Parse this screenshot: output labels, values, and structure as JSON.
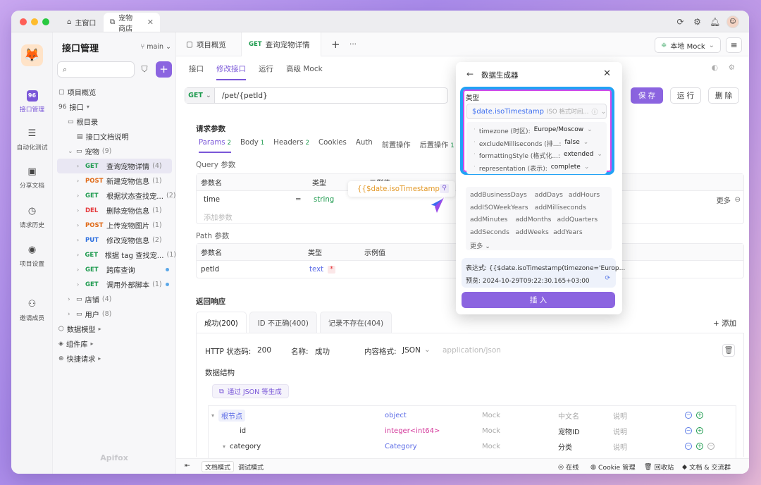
{
  "window": {
    "tabs": [
      {
        "label": "主窗口"
      },
      {
        "label": "宠物商店"
      }
    ]
  },
  "rail": {
    "items": [
      "接口管理",
      "自动化测试",
      "分享文档",
      "请求历史",
      "项目设置",
      "邀请成员"
    ]
  },
  "sidebar": {
    "title": "接口管理",
    "branch": "main",
    "tree": [
      {
        "label": "项目概览",
        "indent": 0,
        "icon": "▢"
      },
      {
        "label": "接口",
        "indent": 0,
        "icon": "96",
        "suffix": "▾"
      },
      {
        "label": "根目录",
        "indent": 1,
        "icon": "▭"
      },
      {
        "label": "接口文档说明",
        "indent": 2,
        "icon": "▤"
      },
      {
        "label": "宠物",
        "indent": 1,
        "icon": "▭",
        "count": "(9)",
        "expand": "⌄"
      },
      {
        "method": "GET",
        "label": "查询宠物详情",
        "count": "(4)",
        "indent": 2,
        "selected": true
      },
      {
        "method": "POST",
        "label": "新建宠物信息",
        "count": "(1)",
        "indent": 2
      },
      {
        "method": "GET",
        "label": "根据状态查找宠...",
        "count": "(2)",
        "indent": 2
      },
      {
        "method": "DEL",
        "label": "删除宠物信息",
        "count": "(1)",
        "indent": 2
      },
      {
        "method": "POST",
        "label": "上传宠物图片",
        "count": "(1)",
        "indent": 2
      },
      {
        "method": "PUT",
        "label": "修改宠物信息",
        "count": "(2)",
        "indent": 2
      },
      {
        "method": "GET",
        "label": "根据 tag 查找宠...",
        "count": "(1)",
        "indent": 2
      },
      {
        "method": "GET",
        "label": "跨库查询",
        "count": "",
        "indent": 2,
        "dot": true
      },
      {
        "method": "GET",
        "label": "调用外部脚本",
        "count": "(1)",
        "indent": 2,
        "dot": true
      },
      {
        "label": "店铺",
        "indent": 1,
        "icon": "▭",
        "count": "(4)",
        "expand": "›"
      },
      {
        "label": "用户",
        "indent": 1,
        "icon": "▭",
        "count": "(8)",
        "expand": "›"
      },
      {
        "label": "数据模型",
        "indent": 0,
        "icon": "⬡",
        "suffix": "▸"
      },
      {
        "label": "组件库",
        "indent": 0,
        "icon": "◈",
        "suffix": "▸"
      },
      {
        "label": "快捷请求",
        "indent": 0,
        "icon": "⊕",
        "suffix": "▸"
      }
    ],
    "footer": "Apifox"
  },
  "doctabs": {
    "overview": "项目概览",
    "method": "GET",
    "current": "查询宠物详情",
    "mock": "本地 Mock"
  },
  "subtabs": [
    "接口",
    "修改接口",
    "运行",
    "高级 Mock"
  ],
  "url": {
    "method": "GET",
    "path": "/pet/{petId}"
  },
  "buttons": {
    "save": "保 存",
    "run": "运 行",
    "delete": "删 除"
  },
  "req": {
    "title": "请求参数",
    "tabs": [
      {
        "label": "Params",
        "badge": "2"
      },
      {
        "label": "Body",
        "badge": "1"
      },
      {
        "label": "Headers",
        "badge": "2"
      },
      {
        "label": "Cookies",
        "badge": ""
      },
      {
        "label": "Auth",
        "badge": ""
      },
      {
        "label": "前置操作",
        "badge": ""
      },
      {
        "label": "后置操作",
        "badge": "1"
      }
    ],
    "query_title": "Query 参数",
    "col_name": "参数名",
    "col_type": "类型",
    "col_example": "示例值",
    "query_row": {
      "name": "time",
      "eq": "=",
      "type": "string",
      "example": "{{$date.isoTimestamp}}"
    },
    "add_param": "添加参数",
    "more": "更多",
    "path_title": "Path 参数",
    "path_row": {
      "name": "petId",
      "type": "text",
      "required": "*"
    }
  },
  "resp": {
    "title": "返回响应",
    "tabs": [
      "成功(200)",
      "ID 不正确(400)",
      "记录不存在(404)"
    ],
    "add": "+ 添加",
    "status_label": "HTTP 状态码:",
    "status": "200",
    "name_label": "名称:",
    "name": "成功",
    "format_label": "内容格式:",
    "format": "JSON",
    "content_type": "application/json",
    "structure": "数据结构",
    "gen_json": "通过 JSON 等生成",
    "rows": [
      {
        "name": "根节点",
        "type": "object",
        "mock": "Mock",
        "cn": "中文名",
        "desc": "说明"
      },
      {
        "name": "id",
        "type": "integer<int64>",
        "mock": "Mock",
        "cn": "宠物ID",
        "desc": "说明"
      },
      {
        "name": "category",
        "type": "Category",
        "mock": "Mock",
        "cn": "分类",
        "desc": "说明"
      }
    ]
  },
  "bottom": {
    "doc_mode": "文档模式",
    "debug_mode": "调试模式",
    "online": "在线",
    "cookie": "Cookie 管理",
    "trash": "回收站",
    "docs": "文档 & 交流群"
  },
  "popup": {
    "title": "数据生成器",
    "type_label": "类型",
    "selected": "$date.isoTimestamp",
    "selected_hint": "ISO 格式时间...",
    "options": [
      {
        "key": "timezone (时区):",
        "value": "Europe/Moscow"
      },
      {
        "key": "excludeMilliseconds (排...:",
        "value": "false"
      },
      {
        "key": "formattingStyle (格式化...:",
        "value": "extended"
      },
      {
        "key": "representation (表示):",
        "value": "complete"
      }
    ],
    "methods": [
      "addBusinessDays",
      "addDays",
      "addHours",
      "addISOWeekYears",
      "addMilliseconds",
      "addMinutes",
      "addMonths",
      "addQuarters",
      "addSeconds",
      "addWeeks",
      "addYears"
    ],
    "more": "更多",
    "expr_label": "表达式:",
    "expr": "{{$date.isoTimestamp(timezone='Europ...",
    "preview_label": "预览:",
    "preview": "2024-10-29T09:22:30.165+03:00",
    "insert": "插 入"
  },
  "colors": {
    "accent": "#8b64e0",
    "get": "#1c9a4d",
    "post": "#e06a17",
    "del": "#e5383b",
    "put": "#2d6fdf",
    "glow_blue": "#22a2f5",
    "glow_pink": "#cf48e9"
  }
}
